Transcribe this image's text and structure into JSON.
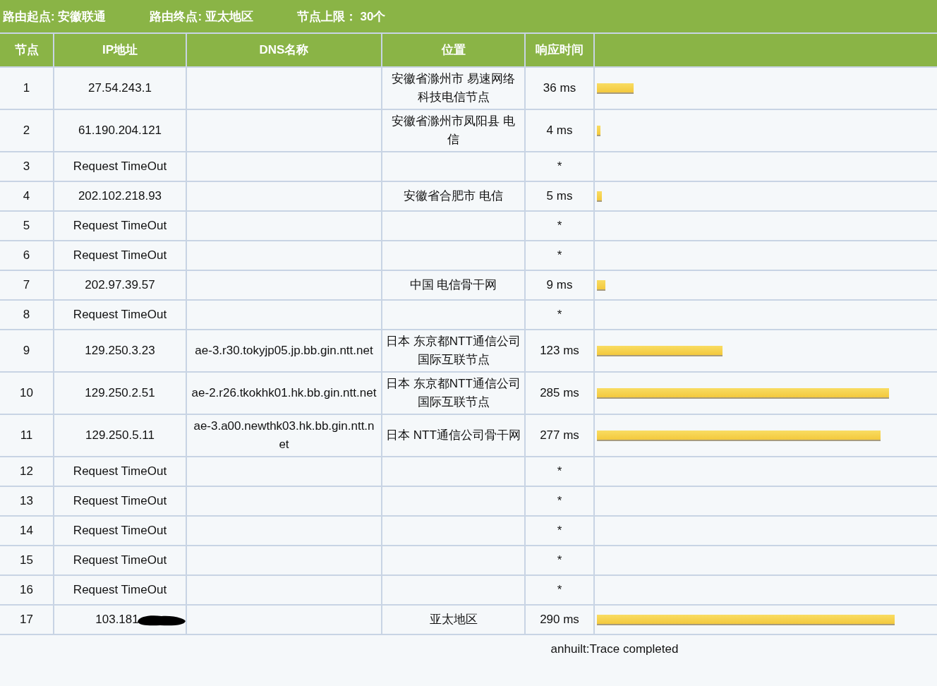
{
  "summary": [
    {
      "label": "路由起点:",
      "value": "安徽联通"
    },
    {
      "label": "路由终点:",
      "value": "亚太地区"
    },
    {
      "label": "节点上限：",
      "value": "30个"
    }
  ],
  "table": {
    "columns": [
      "节点",
      "IP地址",
      "DNS名称",
      "位置",
      "响应时间"
    ],
    "rows": [
      {
        "hop": "1",
        "ip": "27.54.243.1",
        "location": "安徽省滁州市 易速网络科技电信节点",
        "time": "36 ms",
        "level": 0.114
      },
      {
        "hop": "2",
        "ip": "61.190.204.121",
        "location": "安徽省滁州市凤阳县 电信",
        "time": "4 ms",
        "level": 0.012
      },
      {
        "hop": "3",
        "ip": "Request TimeOut",
        "time": "*"
      },
      {
        "hop": "4",
        "ip": "202.102.218.93",
        "location": "安徽省合肥市 电信",
        "time": "5 ms",
        "level": 0.015
      },
      {
        "hop": "5",
        "ip": "Request TimeOut",
        "time": "*"
      },
      {
        "hop": "6",
        "ip": "Request TimeOut",
        "time": "*"
      },
      {
        "hop": "7",
        "ip": "202.97.39.57",
        "location": "中国 电信骨干网",
        "time": "9 ms",
        "level": 0.027
      },
      {
        "hop": "8",
        "ip": "Request TimeOut",
        "time": "*"
      },
      {
        "hop": "9",
        "ip": "129.250.3.23",
        "dns": "ae-3.r30.tokyjp05.jp.bb.gin.ntt.net",
        "location": "日本 东京都NTT通信公司国际互联节点",
        "time": "123 ms",
        "level": 0.394
      },
      {
        "hop": "10",
        "ip": "129.250.2.51",
        "dns": "ae-2.r26.tkokhk01.hk.bb.gin.ntt.net",
        "location": "日本 东京都NTT通信公司国际互联节点",
        "time": "285 ms",
        "level": 0.915
      },
      {
        "hop": "11",
        "ip": "129.250.5.11",
        "dns": "ae-3.a00.newthk03.hk.bb.gin.ntt.net",
        "location": "日本 NTT通信公司骨干网",
        "time": "277 ms",
        "level": 0.89
      },
      {
        "hop": "12",
        "ip": "Request TimeOut",
        "time": "*"
      },
      {
        "hop": "13",
        "ip": "Request TimeOut",
        "time": "*"
      },
      {
        "hop": "14",
        "ip": "Request TimeOut",
        "time": "*"
      },
      {
        "hop": "15",
        "ip": "Request TimeOut",
        "time": "*"
      },
      {
        "hop": "16",
        "ip": "Request TimeOut",
        "time": "*"
      },
      {
        "hop": "17",
        "ip": "103.181",
        "redacted": true,
        "location": "亚太地区",
        "time": "290 ms",
        "level": 0.934
      }
    ]
  },
  "status": "anhuilt:Trace completed"
}
